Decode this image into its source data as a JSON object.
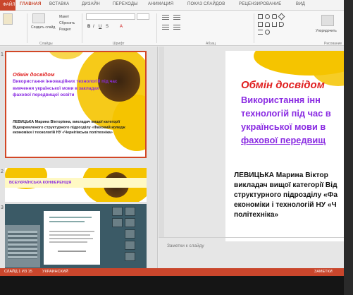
{
  "ribbon": {
    "tabs": [
      "ФАЙЛ",
      "ГЛАВНАЯ",
      "ВСТАВКА",
      "ДИЗАЙН",
      "ПЕРЕХОДЫ",
      "АНИМАЦИЯ",
      "ПОКАЗ СЛАЙДОВ",
      "РЕЦЕНЗИРОВАНИЕ",
      "ВИД"
    ],
    "active_tab": "ГЛАВНАЯ",
    "create_slide": "Создать слайд",
    "layout": "Макет",
    "reset": "Сбросить",
    "section": "Раздел",
    "group_slides": "Слайды",
    "group_font": "Шрифт",
    "group_paragraph": "Абзац",
    "group_drawing": "Рисование",
    "arrange": "Упорядочить"
  },
  "thumbnails": [
    {
      "number": "1",
      "title": "Обмін досвідом",
      "subtitle": "Використання інноваційних технологій під час вивчення української мови в закладах фахової передвищої освіти",
      "author": "ЛЕВИЦЬКА Марина Вікторівна, викладач вищої категорії Відокремленого структурного підрозділу «Фаховий коледж економіки і технологій НУ «Чернігівська політехніка»"
    },
    {
      "number": "2",
      "banner": "ВСЕУКРАЇНСЬКА КОНФЕРЕНЦІЯ"
    },
    {
      "number": "3"
    }
  ],
  "slide": {
    "title": "Обмін досвідом",
    "subtitle_lines": [
      "Використання інн",
      "технологій під час в",
      "української мови в",
      "фахової передвищ"
    ],
    "author_lines": [
      "ЛЕВИЦЬКА Марина Віктор",
      "викладач вищої категорії Від",
      "структурного підрозділу «Фа",
      "економіки і технологій НУ «Ч",
      "політехніка»"
    ]
  },
  "notes_placeholder": "Заметки к слайду",
  "status": {
    "slide_counter": "СЛАЙД 1 ИЗ 15",
    "language": "УКРАИНСКИЙ",
    "notes_button": "ЗАМЕТКИ"
  },
  "colors": {
    "accent": "#c9462c",
    "title_red": "#e02020",
    "subtitle_purple": "#8a2be2",
    "sunflower": "#f5c400"
  }
}
